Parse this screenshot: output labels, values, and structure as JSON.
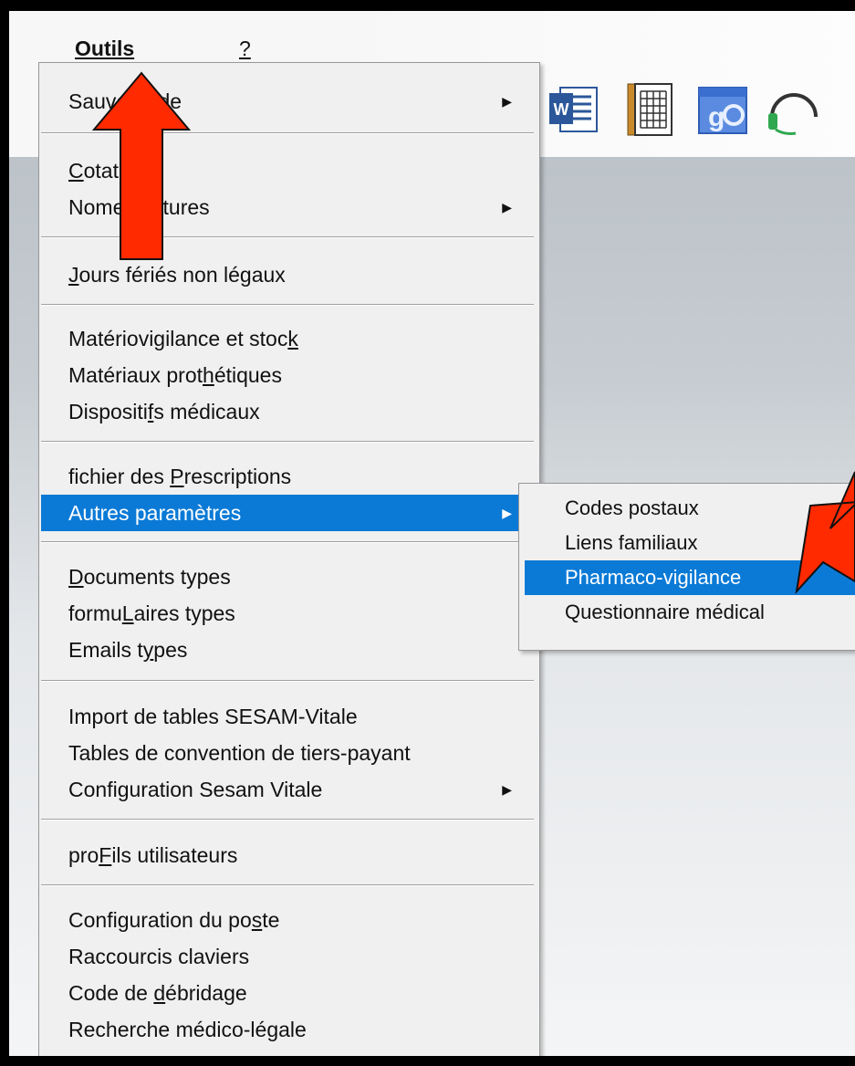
{
  "menubar": {
    "items": [
      {
        "label": "Outils",
        "underline": "O",
        "rest": "utils"
      },
      {
        "label": "?",
        "underline": "?"
      }
    ]
  },
  "toolbar": {
    "icons": [
      "word-icon",
      "calendar-icon",
      "google-contacts-icon",
      "headset-icon"
    ]
  },
  "menu": {
    "items": [
      {
        "parts": [
          "Sauvegarde"
        ],
        "submenu": true
      },
      {
        "parts": [
          "C",
          "otations"
        ],
        "ul": 0
      },
      {
        "parts": [
          "Nom",
          "enclatures"
        ],
        "submenu": true
      },
      {
        "parts": [
          "J",
          "ours fériés non légaux"
        ],
        "ul": 0
      },
      {
        "parts": [
          "Matériovigilance et stoc",
          "k",
          ""
        ],
        "ul": 1
      },
      {
        "parts": [
          "Matériaux prot",
          "h",
          "étiques"
        ],
        "ul": 1
      },
      {
        "parts": [
          "Dispositi",
          "f",
          "s médicaux"
        ],
        "ul": 1
      },
      {
        "parts": [
          "fichier des ",
          "P",
          "rescriptions"
        ],
        "ul": 1
      },
      {
        "parts": [
          "Autres paramètres"
        ],
        "submenu": true,
        "highlighted": true
      },
      {
        "parts": [
          "D",
          "ocuments types"
        ],
        "ul": 0
      },
      {
        "parts": [
          "formu",
          "L",
          "aires types"
        ],
        "ul": 1
      },
      {
        "parts": [
          "Emails t",
          "y",
          "pes"
        ],
        "ul": 1
      },
      {
        "parts": [
          "Import de tables SESAM-Vitale"
        ]
      },
      {
        "parts": [
          "Tables de convention de tiers-payant"
        ]
      },
      {
        "parts": [
          "Configuration Sesam Vitale"
        ],
        "submenu": true
      },
      {
        "parts": [
          "pro",
          "F",
          "ils utilisateurs"
        ],
        "ul": 1
      },
      {
        "parts": [
          "Configuration du po",
          "s",
          "te"
        ],
        "ul": 1
      },
      {
        "parts": [
          "Raccourcis claviers"
        ]
      },
      {
        "parts": [
          "Code de ",
          "d",
          "ébridage"
        ],
        "ul": 1
      },
      {
        "parts": [
          "Recherche médico-légale"
        ]
      }
    ]
  },
  "submenu": {
    "items": [
      {
        "label": "Codes postaux"
      },
      {
        "label": "Liens familiaux"
      },
      {
        "label": "Pharmaco-vigilance",
        "highlighted": true
      },
      {
        "label": "Questionnaire médical"
      }
    ]
  },
  "colors": {
    "highlight": "#0b7ad6",
    "menu_bg": "#f0f0f0",
    "annotation_arrow": "#ff2a00"
  }
}
